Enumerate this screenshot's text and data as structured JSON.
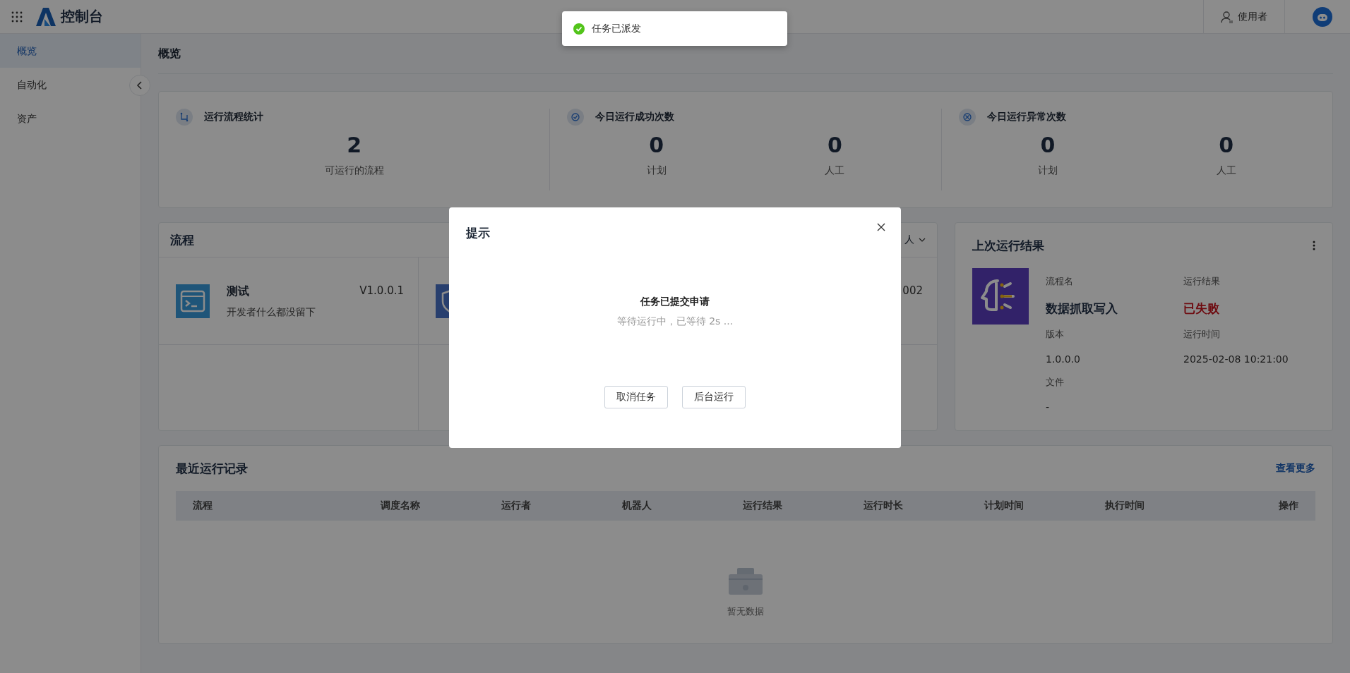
{
  "header": {
    "app_title": "控制台",
    "user": "使用者"
  },
  "toast": {
    "message": "任务已派发",
    "kind": "success"
  },
  "sidebar": {
    "items": [
      {
        "label": "概览",
        "selected": true
      },
      {
        "label": "自动化",
        "selected": false
      },
      {
        "label": "资产",
        "selected": false
      }
    ]
  },
  "page_title": "概览",
  "stats": [
    {
      "title": "运行流程统计",
      "kind": "flows",
      "metrics": [
        {
          "value": "2",
          "label": "可运行的流程"
        }
      ]
    },
    {
      "title": "今日运行成功次数",
      "kind": "success",
      "metrics": [
        {
          "value": "0",
          "label": "计划"
        },
        {
          "value": "0",
          "label": "人工"
        }
      ]
    },
    {
      "title": "今日运行异常次数",
      "kind": "error",
      "metrics": [
        {
          "value": "0",
          "label": "计划"
        },
        {
          "value": "0",
          "label": "人工"
        }
      ]
    }
  ],
  "flows": {
    "title": "流程",
    "filter": "人",
    "items": [
      {
        "kind": "terminal",
        "name": "测试",
        "version": "V1.0.0.1",
        "description": "开发者什么都没留下"
      },
      {
        "kind": "shield",
        "version": "002"
      }
    ]
  },
  "last_run": {
    "title": "上次运行结果",
    "fields": [
      {
        "label": "流程名",
        "value": "数据抓取写入",
        "kind": "name"
      },
      {
        "label": "运行结果",
        "value": "已失败",
        "kind": "failed"
      },
      {
        "label": "版本",
        "value": "1.0.0.0",
        "kind": "plain"
      },
      {
        "label": "运行时间",
        "value": "2025-02-08 10:21:00",
        "kind": "plain"
      },
      {
        "label": "文件",
        "value": "-",
        "kind": "plain"
      }
    ]
  },
  "records": {
    "title": "最近运行记录",
    "more_link": "查看更多",
    "table": {
      "columns": [
        "流程",
        "调度名称",
        "运行者",
        "机器人",
        "运行结果",
        "运行时长",
        "计划时间",
        "执行时间",
        "操作"
      ]
    },
    "empty_text": "暂无数据"
  },
  "dialog": {
    "title": "提示",
    "message": "任务已提交申请",
    "detail": "等待运行中，已等待 2s ...",
    "buttons": [
      "取消任务",
      "后台运行"
    ]
  }
}
